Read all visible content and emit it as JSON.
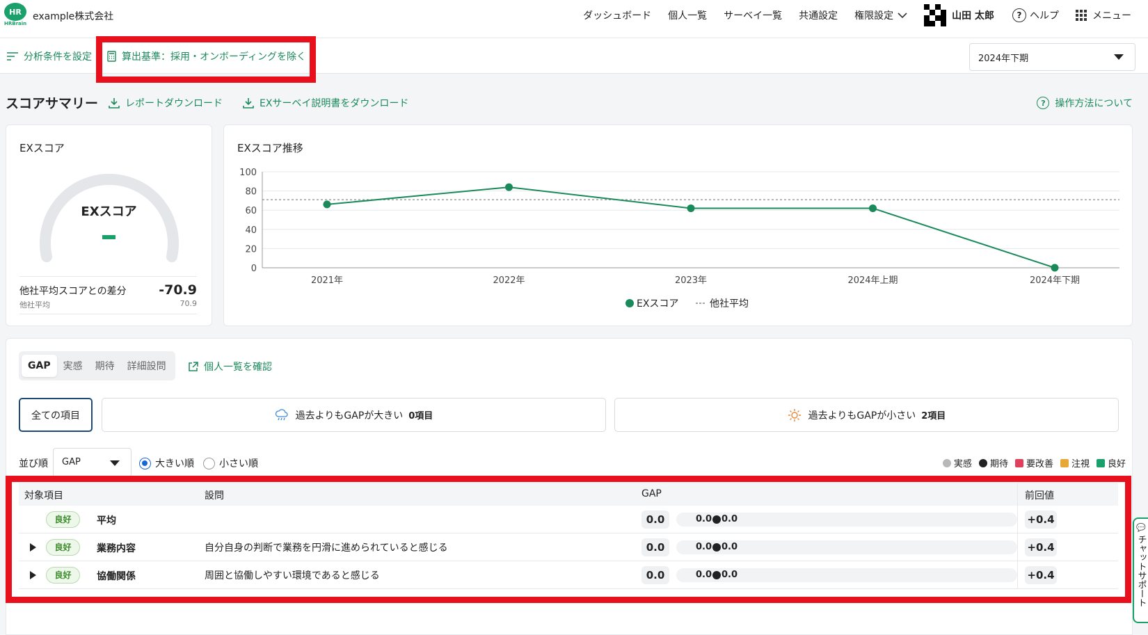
{
  "header": {
    "logo_text": "HR",
    "logo_sub": "HRBrain",
    "company": "example株式会社",
    "nav": [
      "ダッシュボード",
      "個人一覧",
      "サーベイ一覧",
      "共通設定",
      "権限設定"
    ],
    "user": "山田 太郎",
    "help": "ヘルプ",
    "menu": "メニュー"
  },
  "subbar": {
    "filter_label": "分析条件を設定",
    "calc_label": "算出基準：採用・オンボーディングを除く",
    "period": "2024年下期"
  },
  "summary": {
    "title": "スコアサマリー",
    "report_download": "レポートダウンロード",
    "manual_download": "EXサーベイ説明書をダウンロード",
    "howto": "操作方法について"
  },
  "score_card": {
    "title": "EXスコア",
    "gauge_label": "EXスコア",
    "diff_label": "他社平均スコアとの差分",
    "diff_sub": "他社平均",
    "diff_value": "-70.9",
    "diff_subvalue": "70.9"
  },
  "trend_card": {
    "title": "EXスコア推移"
  },
  "chart_data": {
    "type": "line",
    "categories": [
      "2021年",
      "2022年",
      "2023年",
      "2024年上期",
      "2024年下期"
    ],
    "series": [
      {
        "name": "EXスコア",
        "values": [
          66,
          84,
          62,
          62,
          0
        ],
        "color": "#1a8a5a"
      }
    ],
    "reference": {
      "name": "他社平均",
      "value": 70.9
    },
    "ylim": [
      0,
      100
    ],
    "yticks": [
      0,
      20,
      40,
      60,
      80,
      100
    ],
    "grid": true,
    "legend_placement": "bottom"
  },
  "panel": {
    "tabs": [
      "GAP",
      "実感",
      "期待",
      "詳細設問"
    ],
    "individual_link": "個人一覧を確認",
    "filter_all": "全ての項目",
    "filter_bigger": "過去よりもGAPが大きい",
    "filter_bigger_count": "0項目",
    "filter_smaller": "過去よりもGAPが小さい",
    "filter_smaller_count": "2項目",
    "sort_label": "並び順",
    "sort_value": "GAP",
    "radio_desc": "大きい順",
    "radio_asc": "小さい順",
    "legend": [
      {
        "label": "実感",
        "color": "#b8b8b8"
      },
      {
        "label": "期待",
        "color": "#222222"
      },
      {
        "label": "要改善",
        "color": "#e0405a"
      },
      {
        "label": "注視",
        "color": "#e8a838"
      },
      {
        "label": "良好",
        "color": "#1aa06a"
      }
    ]
  },
  "table": {
    "headers": [
      "対象項目",
      "設問",
      "GAP",
      "前回値"
    ],
    "rows": [
      {
        "badge": "良好",
        "item": "平均",
        "question": "",
        "gap": "0.0",
        "v1": "0.0",
        "v2": "0.0",
        "prev": "+0.4"
      },
      {
        "badge": "良好",
        "item": "業務内容",
        "question": "自分自身の判断で業務を円滑に進められていると感じる",
        "gap": "0.0",
        "v1": "0.0",
        "v2": "0.0",
        "prev": "+0.4"
      },
      {
        "badge": "良好",
        "item": "協働関係",
        "question": "周囲と協働しやすい環境であると感じる",
        "gap": "0.0",
        "v1": "0.0",
        "v2": "0.0",
        "prev": "+0.4"
      }
    ]
  },
  "chat": {
    "label": "チャットサポート"
  }
}
